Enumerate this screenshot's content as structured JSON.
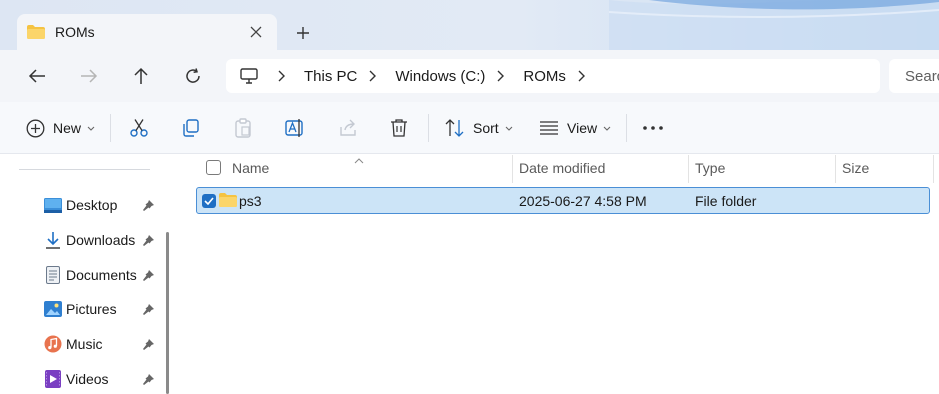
{
  "window": {
    "tab_title": "ROMs",
    "new_tab_icon": "plus-icon",
    "close_icon": "close-icon"
  },
  "navigation": {
    "back_icon": "back-arrow-icon",
    "forward_icon": "forward-arrow-icon",
    "up_icon": "up-arrow-icon",
    "refresh_icon": "refresh-icon"
  },
  "address_bar": {
    "root_icon": "monitor-icon",
    "crumbs": [
      "This PC",
      "Windows (C:)",
      "ROMs"
    ]
  },
  "search": {
    "placeholder": "Search ROMs"
  },
  "command_bar": {
    "new_label": "New",
    "sort_label": "Sort",
    "view_label": "View",
    "icons": [
      "new-icon",
      "cut-icon",
      "copy-icon",
      "paste-icon",
      "rename-icon",
      "share-icon",
      "delete-icon",
      "sort-icon",
      "view-icon",
      "more-icon"
    ]
  },
  "sidebar": {
    "items": [
      {
        "label": "Desktop",
        "icon": "desktop-icon"
      },
      {
        "label": "Downloads",
        "icon": "download-icon"
      },
      {
        "label": "Documents",
        "icon": "documents-icon"
      },
      {
        "label": "Pictures",
        "icon": "pictures-icon"
      },
      {
        "label": "Music",
        "icon": "music-icon"
      },
      {
        "label": "Videos",
        "icon": "videos-icon"
      }
    ]
  },
  "file_list": {
    "columns": {
      "name": "Name",
      "date_modified": "Date modified",
      "type": "Type",
      "size": "Size"
    },
    "rows": [
      {
        "name": "ps3",
        "date_modified": "2025-06-27 4:58 PM",
        "type": "File folder",
        "size": "",
        "selected": true
      }
    ]
  },
  "colors": {
    "accent": "#1f6fc4",
    "selection_bg": "#cce4f7",
    "selection_border": "#4a8fd6",
    "folder_yellow": "#f5c342"
  }
}
